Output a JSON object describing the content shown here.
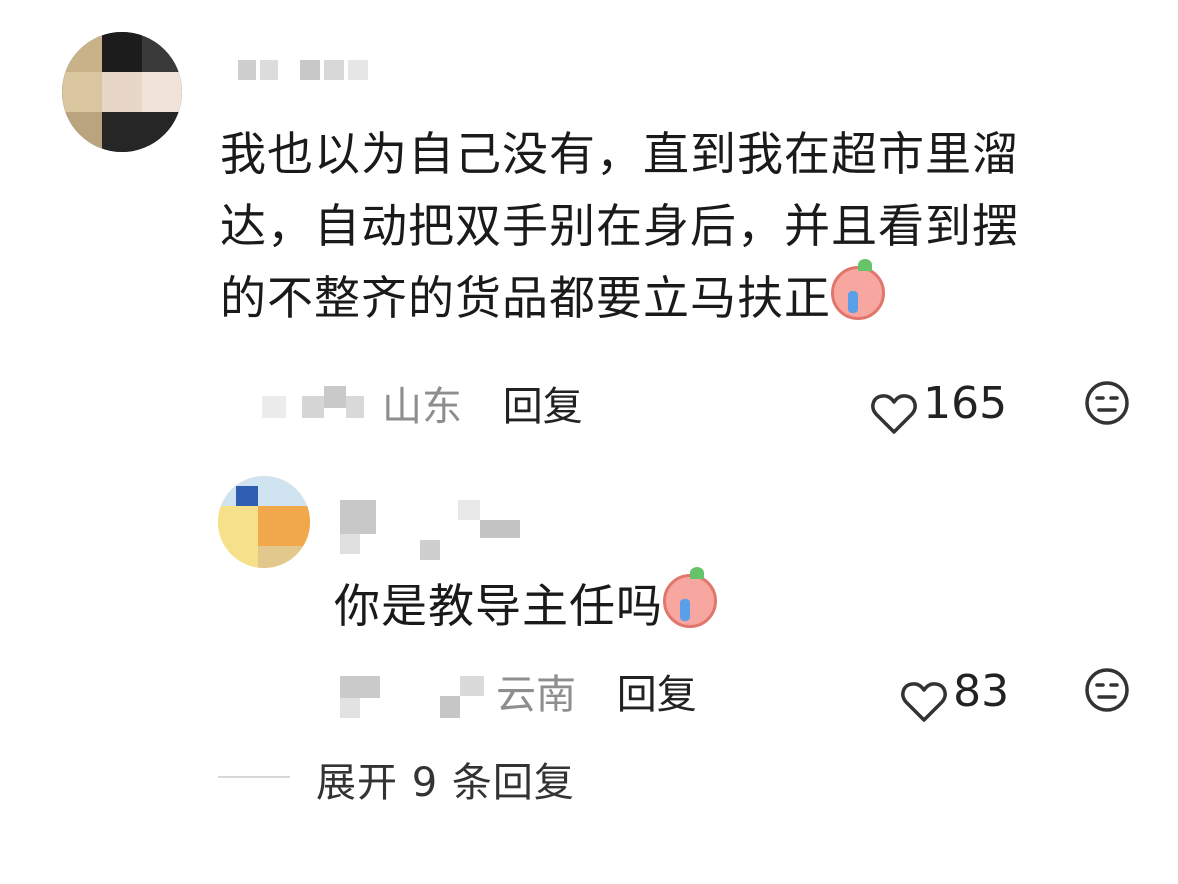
{
  "comment": {
    "text": "我也以为自己没有，直到我在超市里溜达，自动把双手别在身后，并且看到摆的不整齐的货品都要立马扶正",
    "line1": "我也以为自己没有，直到我在超市里溜",
    "line2": "达，自动把双手别在身后，并且看到摆",
    "line3": "的不整齐的货品都要立马扶正",
    "location": "山东",
    "reply_label": "回复",
    "likes": "165"
  },
  "reply": {
    "text": "你是教导主任吗",
    "location": "云南",
    "reply_label": "回复",
    "likes": "83"
  },
  "expand_label": "展开 9 条回复",
  "icons": {
    "like": "heart-outline-icon",
    "dislike": "neutral-face-icon",
    "emoji": "crying-emoji-icon"
  }
}
